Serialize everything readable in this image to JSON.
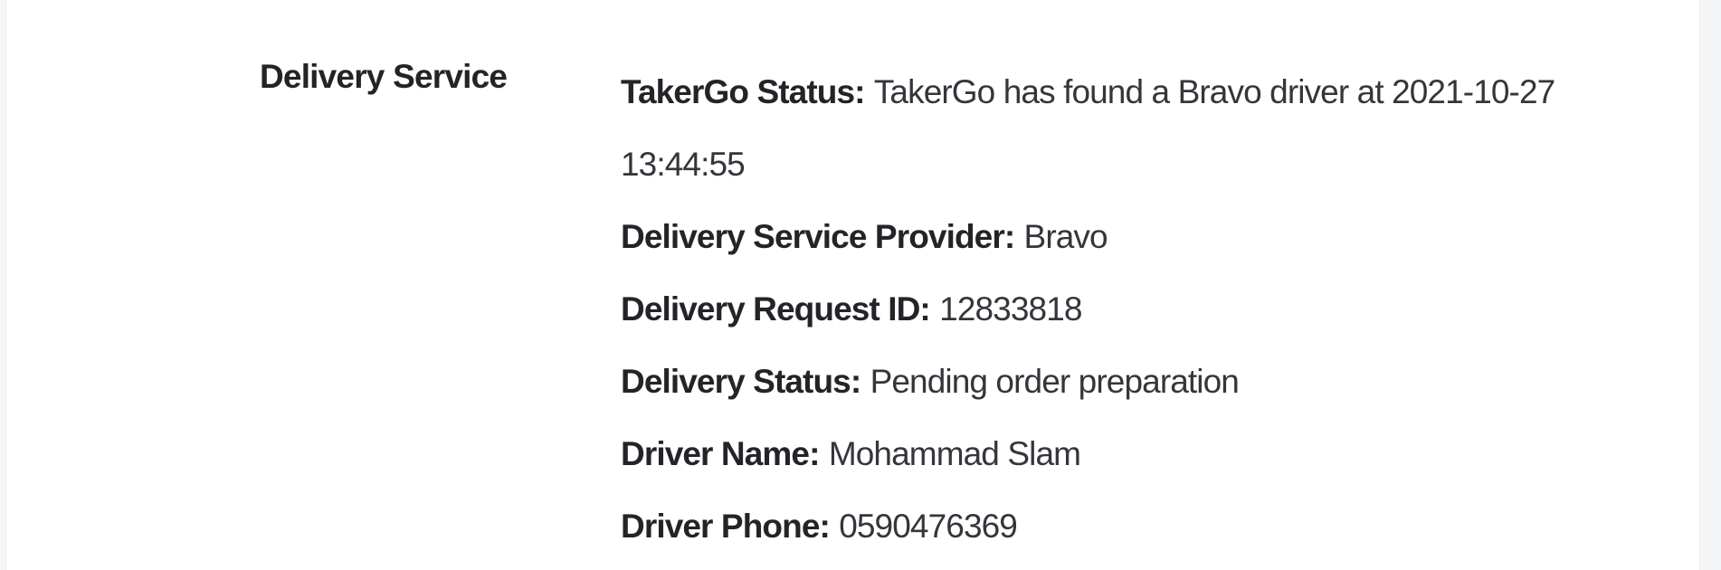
{
  "section": {
    "label": "Delivery Service"
  },
  "details": [
    {
      "key": "TakerGo Status:",
      "value": "TakerGo has found a Bravo driver at 2021-10-27 13:44:55"
    },
    {
      "key": "Delivery Service Provider:",
      "value": "Bravo"
    },
    {
      "key": "Delivery Request ID:",
      "value": "12833818"
    },
    {
      "key": "Delivery Status:",
      "value": "Pending order preparation"
    },
    {
      "key": "Driver Name:",
      "value": "Mohammad Slam"
    },
    {
      "key": "Driver Phone:",
      "value": "0590476369"
    }
  ]
}
